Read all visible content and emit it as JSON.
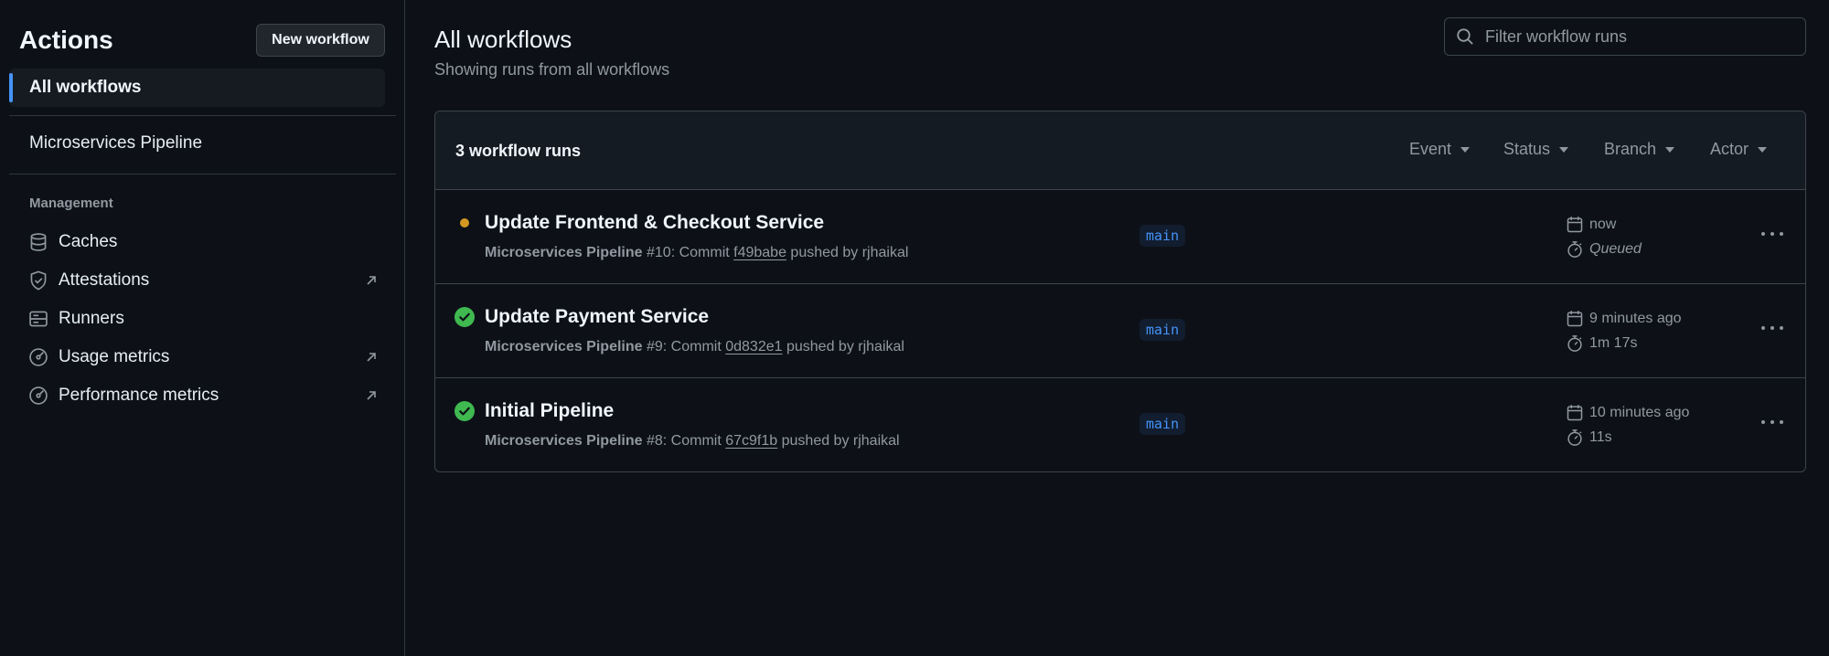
{
  "sidebar": {
    "title": "Actions",
    "new_workflow_label": "New workflow",
    "all_workflows_label": "All workflows",
    "workflows": [
      "Microservices Pipeline"
    ],
    "management_label": "Management",
    "management_items": [
      {
        "label": "Caches",
        "icon": "database-icon",
        "external": false
      },
      {
        "label": "Attestations",
        "icon": "shield-check-icon",
        "external": true
      },
      {
        "label": "Runners",
        "icon": "server-icon",
        "external": false
      },
      {
        "label": "Usage metrics",
        "icon": "meter-icon",
        "external": true
      },
      {
        "label": "Performance metrics",
        "icon": "meter-icon",
        "external": true
      }
    ]
  },
  "main": {
    "title": "All workflows",
    "subtitle": "Showing runs from all workflows",
    "filter_placeholder": "Filter workflow runs",
    "runs_count_label": "3 workflow runs",
    "filters": [
      "Event",
      "Status",
      "Branch",
      "Actor"
    ],
    "runs": [
      {
        "status": "queued",
        "title": "Update Frontend & Checkout Service",
        "workflow": "Microservices Pipeline",
        "run_number": "#10",
        "commit_prefix": ": Commit ",
        "sha": "f49babe",
        "pushed_by": " pushed by rjhaikal",
        "branch": "main",
        "when": "now",
        "duration": "Queued"
      },
      {
        "status": "success",
        "title": "Update Payment Service",
        "workflow": "Microservices Pipeline",
        "run_number": "#9",
        "commit_prefix": ": Commit ",
        "sha": "0d832e1",
        "pushed_by": " pushed by rjhaikal",
        "branch": "main",
        "when": "9 minutes ago",
        "duration": "1m 17s"
      },
      {
        "status": "success",
        "title": "Initial Pipeline",
        "workflow": "Microservices Pipeline",
        "run_number": "#8",
        "commit_prefix": ": Commit ",
        "sha": "67c9f1b",
        "pushed_by": " pushed by rjhaikal",
        "branch": "main",
        "when": "10 minutes ago",
        "duration": "11s"
      }
    ]
  },
  "colors": {
    "background": "#0d1117",
    "accent": "#4493f8",
    "success": "#3fb950",
    "queued": "#d29922",
    "muted": "#9198a1"
  }
}
